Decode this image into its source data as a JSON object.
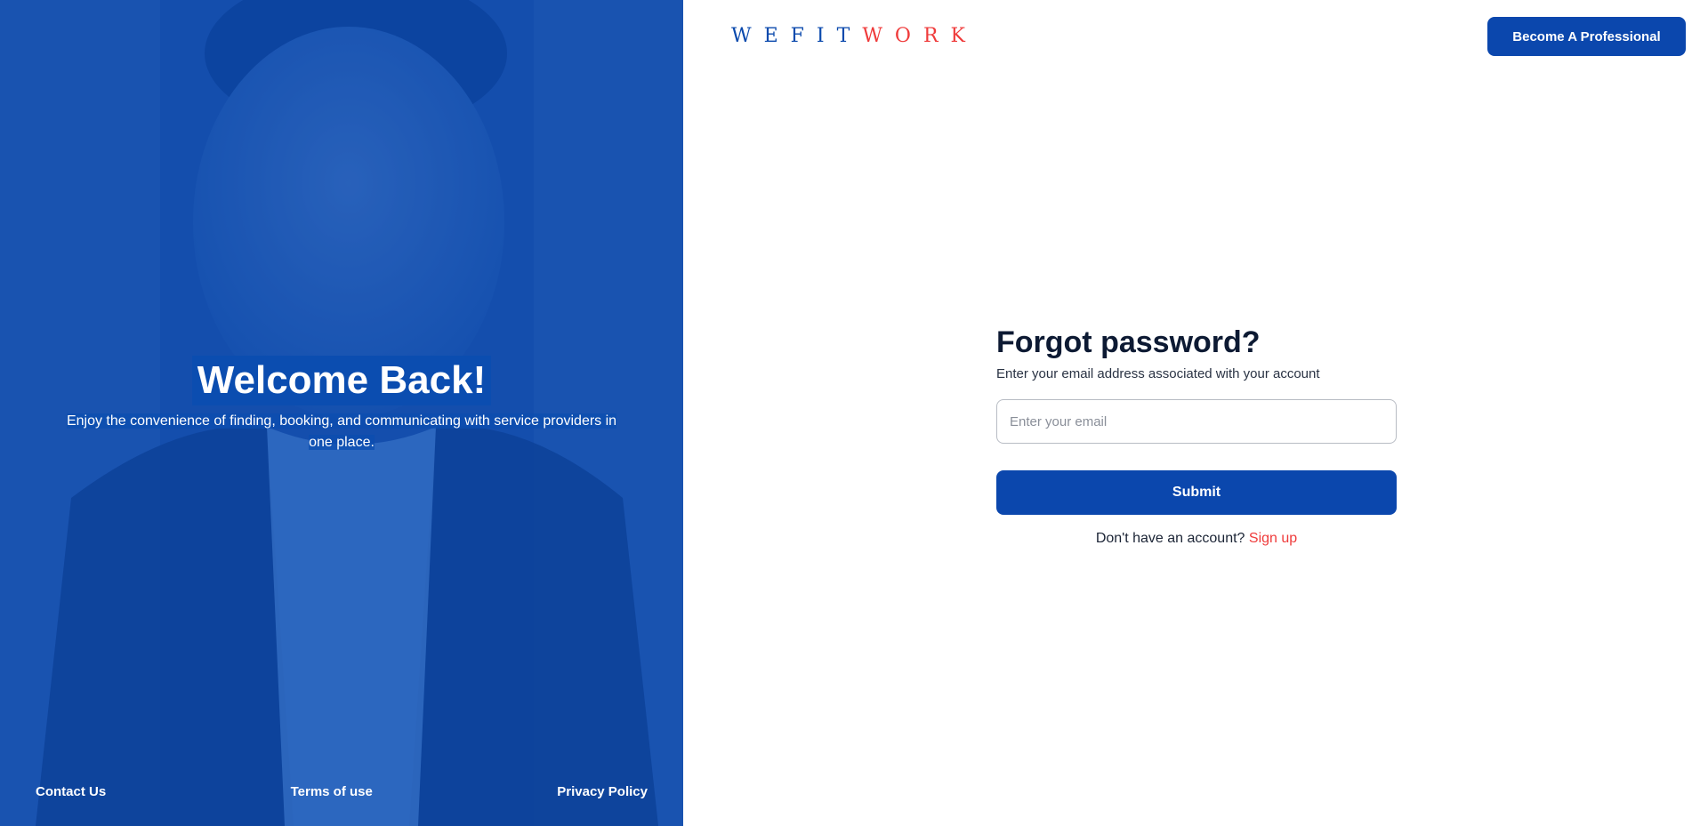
{
  "hero": {
    "title": "Welcome Back!",
    "subtitle": "Enjoy the convenience of finding, booking, and communicating with service providers in one place.",
    "footer_links": [
      "Contact Us",
      "Terms of use",
      "Privacy Policy"
    ]
  },
  "header": {
    "logo_part1": "WEFIT",
    "logo_part2": "WORK",
    "cta_label": "Become A Professional"
  },
  "form": {
    "title": "Forgot password?",
    "subtitle": "Enter your email address associated with your account",
    "email_placeholder": "Enter your email",
    "email_value": "",
    "submit_label": "Submit",
    "signup_prompt": "Don't have an account?",
    "signup_link": "Sign up"
  },
  "colors": {
    "brand_blue": "#0b47ad",
    "accent_red": "#ef3b3b",
    "text_dark": "#0d1a33"
  }
}
